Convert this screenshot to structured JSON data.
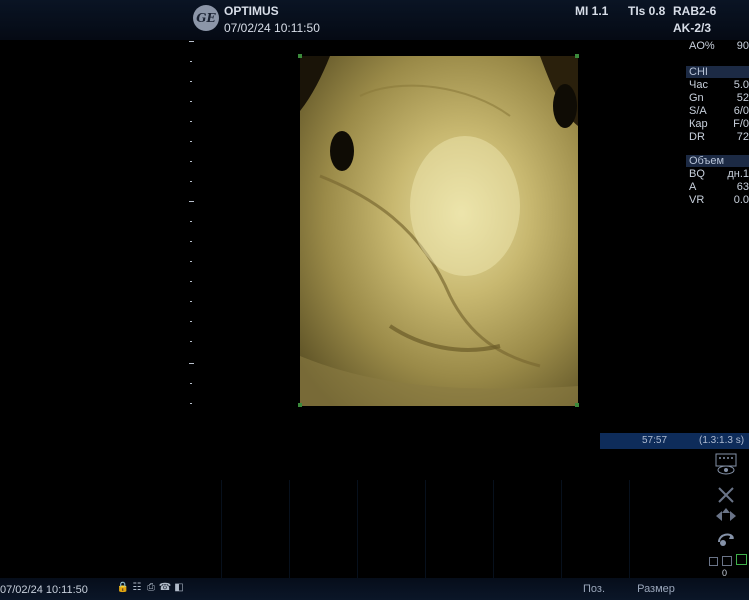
{
  "header": {
    "logo_text": "GE",
    "device": "OPTIMUS",
    "datetime": "07/02/24 10:11:50",
    "mi": "MI 1.1",
    "tis": "TIs 0.8",
    "probe": "RAB2-6",
    "preset": "AK-2/3"
  },
  "params": {
    "ao": {
      "label": "AO%",
      "value": "90"
    },
    "group1_title": "CHI",
    "group1": [
      {
        "label": "Час",
        "value": "5.0"
      },
      {
        "label": "Gn",
        "value": "52"
      },
      {
        "label": "S/A",
        "value": "6/0"
      },
      {
        "label": "Кар",
        "value": "F/0"
      },
      {
        "label": "DR",
        "value": "72"
      }
    ],
    "group2_title": "Объем",
    "group2": [
      {
        "label": "BQ",
        "value": "дн.1"
      },
      {
        "label": "A",
        "value": "63"
      },
      {
        "label": "VR",
        "value": "0.0"
      }
    ]
  },
  "cine": {
    "frame": "57:57",
    "speed": "(1.3:1.3 s)"
  },
  "footer": {
    "date": "07/02/24 10:11:50",
    "pos_label": "Поз.",
    "size_label": "Размер",
    "counter": "0"
  },
  "colors": {
    "header_bg": "#0a1424",
    "cine_bg": "#0e2c5a",
    "param_hdr_bg": "#1c2a44"
  }
}
